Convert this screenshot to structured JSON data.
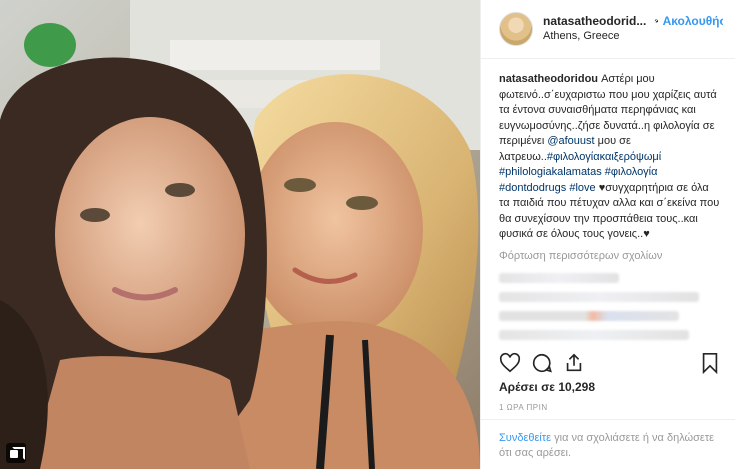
{
  "header": {
    "username": "natasatheodorid...",
    "separator": "•",
    "follow_label": "Ακολουθήστε",
    "location": "Athens, Greece"
  },
  "caption": {
    "username": "natasatheodoridou",
    "text1": " Αστέρι μου φωτεινό..σ΄ευχαριστω που μου χαρίζεις αυτά τα έντονα συναισθήματα περηφάνιας και ευγνωμοσύνης..ζήσε δυνατά..η φιλολογία σε περιμένει ",
    "mention": "@afouust",
    "text2": " μου σε λατρευω..",
    "tag1": "#φιλολογίακαιξερόψωμί",
    "tag2": "#philologiakalamatas",
    "tag3": "#φιλολογία",
    "tag4": "#dontdodrugs",
    "tag5": "#love",
    "text3": " ♥συγχαρητήρια σε όλα τα παιδιά που πέτυχαν αλλα και σ΄εκείνα που θα συνεχίσουν την προσπάθεια τους..και φυσικά σε όλους τους γονεις..♥"
  },
  "load_more": "Φόρτωση περισσότερων σχολίων",
  "likes": "Αρέσει σε 10,298",
  "time": "1 ΩΡΑ ΠΡΙΝ",
  "comment": {
    "login_link": "Συνδεθείτε",
    "text": " για να σχολιάσετε ή να δηλώσετε ότι σας αρέσει."
  },
  "colors": {
    "accent": "#3897f0",
    "hashtag": "#003569",
    "muted": "#999999"
  }
}
